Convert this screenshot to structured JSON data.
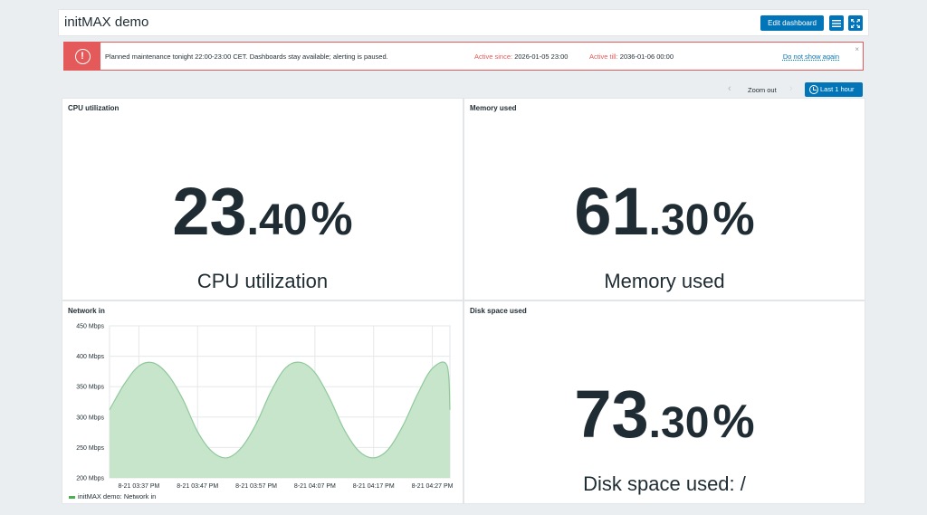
{
  "header": {
    "title": "initMAX demo",
    "edit_label": "Edit dashboard"
  },
  "banner": {
    "message": "Planned maintenance tonight 22:00-23:00 CET. Dashboards stay available; alerting is paused.",
    "active_since_label": "Active since:",
    "active_since": "2026-01-05 23:00",
    "active_till_label": "Active till:",
    "active_till": "2036-01-06 00:00",
    "dismiss": "Do not show again",
    "alert_glyph": "!",
    "close_glyph": "×"
  },
  "time": {
    "prev": "‹",
    "zoom_out": "Zoom out",
    "next": "›",
    "range": "Last 1 hour"
  },
  "widgets": {
    "cpu": {
      "title": "CPU utilization",
      "int": "23",
      "dec": ".40",
      "unit": "%",
      "desc": "CPU utilization"
    },
    "mem": {
      "title": "Memory used",
      "int": "61",
      "dec": ".30",
      "unit": "%",
      "desc": "Memory used"
    },
    "disk": {
      "title": "Disk space used",
      "int": "73",
      "dec": ".30",
      "unit": "%",
      "desc": "Disk space used: /"
    },
    "net": {
      "title": "Network in",
      "legend": "initMAX demo: Network in"
    }
  },
  "colors": {
    "accent": "#0275b8",
    "alert": "#e45959",
    "series_fill": "#c7e5cb",
    "series_line": "#8fc99a"
  },
  "chart_data": {
    "type": "area",
    "ylim": [
      200,
      450
    ],
    "yticks": [
      {
        "v": 450,
        "label": "450 Mbps"
      },
      {
        "v": 400,
        "label": "400 Mbps"
      },
      {
        "v": 350,
        "label": "350 Mbps"
      },
      {
        "v": 300,
        "label": "300 Mbps"
      },
      {
        "v": 250,
        "label": "250 Mbps"
      },
      {
        "v": 200,
        "label": "200 Mbps"
      }
    ],
    "xlim": [
      0,
      58
    ],
    "xticks": [
      {
        "v": 5,
        "label": "8-21 03:37 PM"
      },
      {
        "v": 15,
        "label": "8-21 03:47 PM"
      },
      {
        "v": 25,
        "label": "8-21 03:57 PM"
      },
      {
        "v": 35,
        "label": "8-21 04:07 PM"
      },
      {
        "v": 45,
        "label": "8-21 04:17 PM"
      },
      {
        "v": 55,
        "label": "8-21 04:27 PM"
      }
    ],
    "series": [
      {
        "name": "initMAX demo: Network in",
        "x": [
          0,
          2.5,
          5,
          7.5,
          10,
          12.5,
          15,
          17.5,
          20,
          22.5,
          25,
          27.5,
          30,
          32.5,
          35,
          37.5,
          40,
          42.5,
          45,
          47.5,
          50,
          52.5,
          55,
          57.5,
          58
        ],
        "values": [
          312,
          354,
          384,
          389,
          369,
          329,
          276,
          243,
          233,
          250,
          289,
          342,
          381,
          390,
          373,
          331,
          279,
          244,
          233,
          247,
          286,
          338,
          380,
          385,
          312
        ]
      }
    ]
  }
}
